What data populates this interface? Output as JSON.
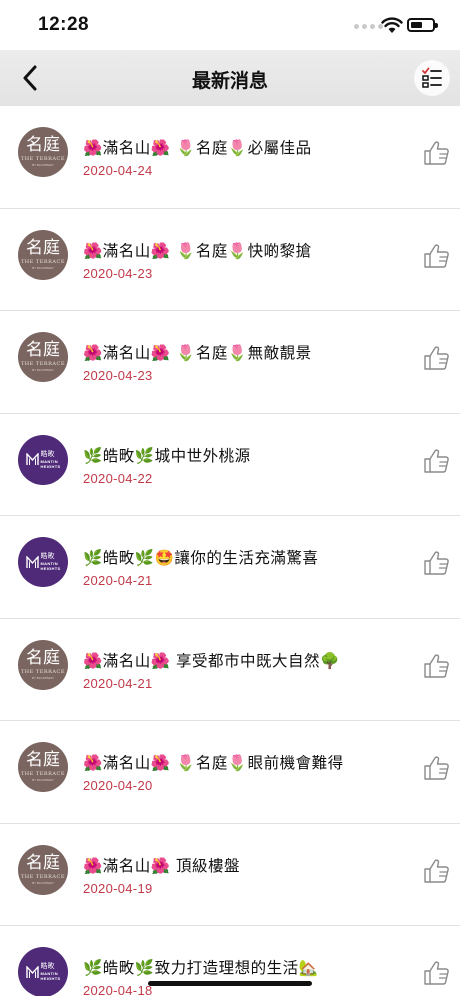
{
  "status_bar": {
    "time": "12:28",
    "battery_level": 0.55
  },
  "nav": {
    "title": "最新消息",
    "back_icon": "chevron-left-icon",
    "list_icon": "checklist-icon"
  },
  "logos": {
    "terrace": {
      "main": "名庭",
      "sub": "THE TERRACE",
      "tiny": "BY BLOOMWAY"
    },
    "mantin": {
      "zh": "皓畋",
      "en1": "MANTIN",
      "en2": "HEIGHTS"
    }
  },
  "news": [
    {
      "brand": "terrace",
      "title": "🌺滿名山🌺 🌷名庭🌷必屬佳品",
      "date": "2020-04-24"
    },
    {
      "brand": "terrace",
      "title": "🌺滿名山🌺 🌷名庭🌷快啲黎搶",
      "date": "2020-04-23"
    },
    {
      "brand": "terrace",
      "title": "🌺滿名山🌺 🌷名庭🌷無敵靚景",
      "date": "2020-04-23"
    },
    {
      "brand": "mantin",
      "title": "🌿皓畋🌿城中世外桃源",
      "date": "2020-04-22"
    },
    {
      "brand": "mantin",
      "title": "🌿皓畋🌿🤩讓你的生活充滿驚喜",
      "date": "2020-04-21"
    },
    {
      "brand": "terrace",
      "title": "🌺滿名山🌺 享受都市中既大自然🌳",
      "date": "2020-04-21"
    },
    {
      "brand": "terrace",
      "title": "🌺滿名山🌺 🌷名庭🌷眼前機會難得",
      "date": "2020-04-20"
    },
    {
      "brand": "terrace",
      "title": "🌺滿名山🌺 頂級樓盤",
      "date": "2020-04-19"
    },
    {
      "brand": "mantin",
      "title": "🌿皓畋🌿致力打造理想的生活🏡",
      "date": "2020-04-18"
    }
  ],
  "colors": {
    "date": "#c23a4a",
    "terrace_bg": "#7a6560",
    "mantin_bg": "#4f2a78"
  }
}
